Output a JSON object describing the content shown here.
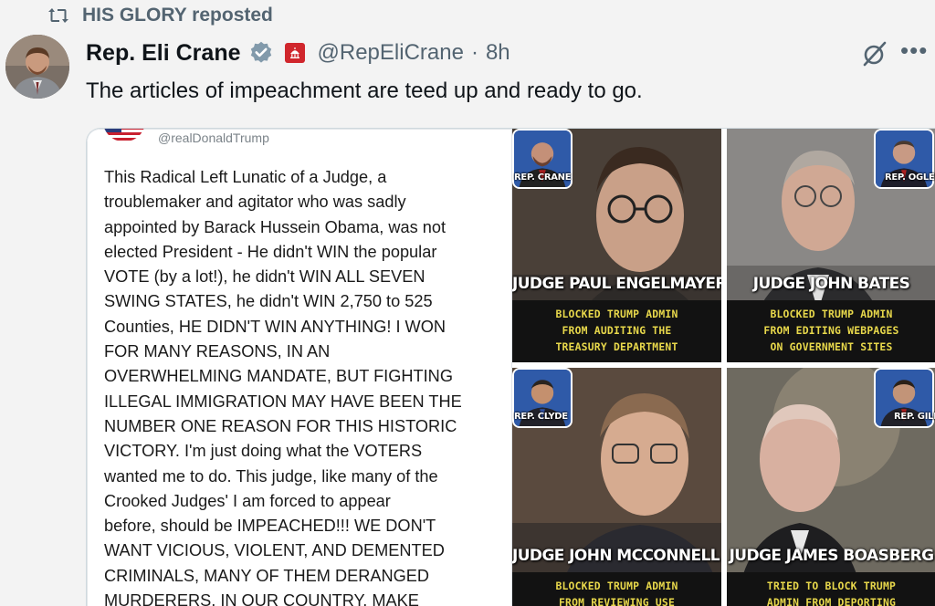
{
  "repost": {
    "label": "HIS GLORY reposted"
  },
  "author": {
    "name": "Rep. Eli Crane",
    "handle": "@RepEliCrane",
    "separator": "·",
    "time": "8h"
  },
  "tweet": {
    "text": "The articles of impeachment are teed up and ready to go."
  },
  "quoted_screenshot": {
    "handle": "@realDonaldTrump",
    "lines": [
      "This Radical Left Lunatic of a Judge, a",
      "troublemaker and agitator who was sadly",
      "appointed by Barack Hussein Obama, was not",
      "elected President - He didn't WIN the popular",
      "VOTE (by a lot!), he didn't WIN ALL SEVEN",
      "SWING STATES, he didn't WIN 2,750 to 525",
      "Counties, HE DIDN'T WIN ANYTHING! I WON",
      "FOR MANY REASONS, IN AN",
      "OVERWHELMING MANDATE, BUT FIGHTING",
      "ILLEGAL IMMIGRATION MAY HAVE BEEN THE",
      "NUMBER ONE REASON FOR THIS HISTORIC",
      "VICTORY. I'm just doing what the VOTERS",
      "wanted me to do. This judge, like many of the",
      "Crooked Judges' I am forced to appear",
      "before, should be IMPEACHED!!! WE DON'T",
      "WANT VICIOUS, VIOLENT, AND DEMENTED",
      "CRIMINALS, MANY OF THEM DERANGED",
      "MURDERERS, IN OUR COUNTRY. MAKE"
    ]
  },
  "judges": [
    {
      "rep": "REP. CRANE",
      "name": "JUDGE PAUL ENGELMAYER",
      "caption": [
        "BLOCKED TRUMP ADMIN",
        "FROM AUDITING THE",
        "TREASURY DEPARTMENT"
      ]
    },
    {
      "rep": "REP. OGLES",
      "name": "JUDGE JOHN BATES",
      "caption": [
        "BLOCKED TRUMP ADMIN",
        "FROM EDITING WEBPAGES",
        "ON GOVERNMENT SITES"
      ]
    },
    {
      "rep": "REP. CLYDE",
      "name": "JUDGE JOHN MCCONNELL JR.",
      "caption": [
        "BLOCKED TRUMP ADMIN",
        "FROM REVIEWING USE"
      ]
    },
    {
      "rep": "REP. GILL",
      "name": "JUDGE JAMES BOASBERG",
      "caption": [
        "TRIED TO BLOCK TRUMP",
        "ADMIN FROM DEPORTING"
      ]
    }
  ],
  "colors": {
    "verified": "#829aab",
    "capitol_badge": "#d0262c",
    "caption_text": "#e8d84b",
    "secondary_text": "#536471"
  },
  "icons": {
    "repost": "repost-icon",
    "verified": "verified-badge-icon",
    "affiliate": "capitol-icon",
    "grok": "grok-icon",
    "more": "more-icon"
  }
}
